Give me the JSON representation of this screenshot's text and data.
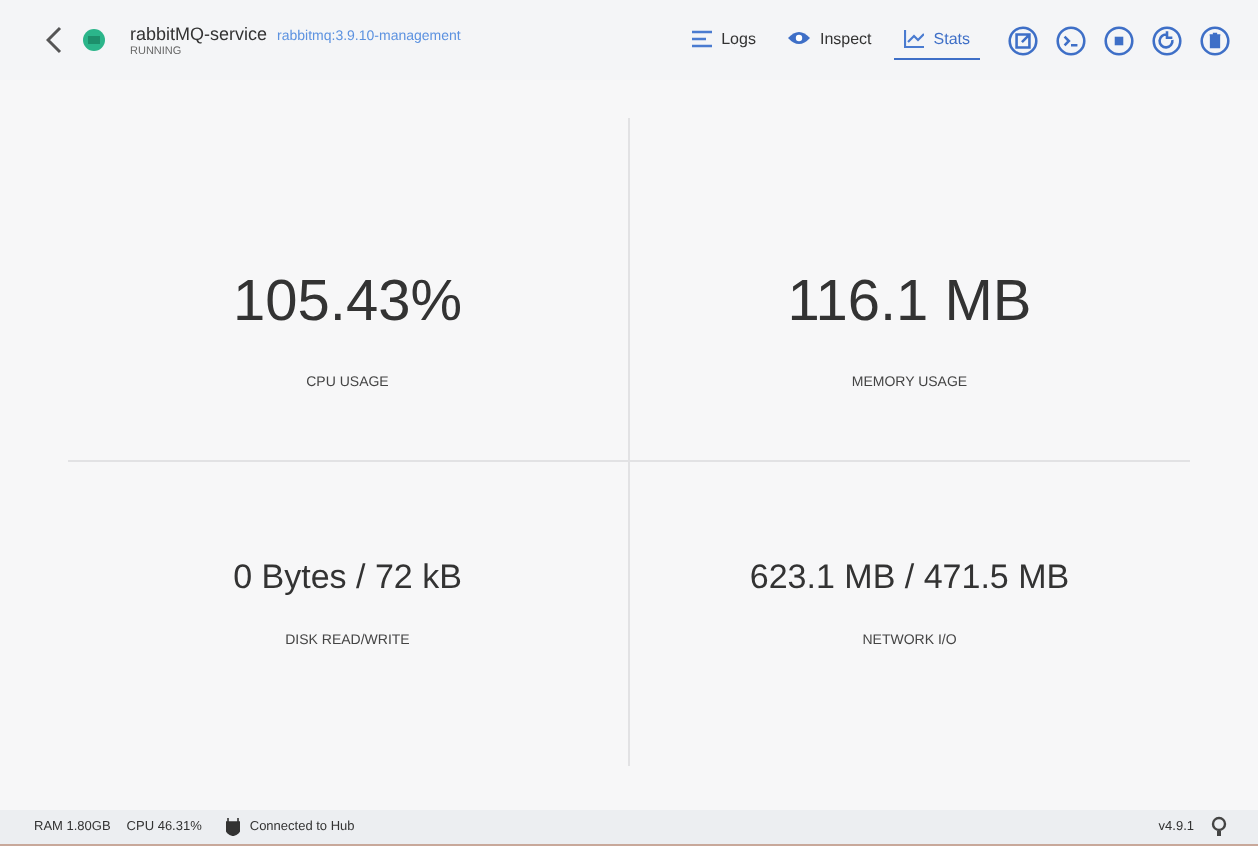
{
  "header": {
    "name": "rabbitMQ-service",
    "image": "rabbitmq:3.9.10-management",
    "status": "RUNNING"
  },
  "tabs": [
    {
      "kind": "logs",
      "label": "Logs",
      "selected": false
    },
    {
      "kind": "inspect",
      "label": "Inspect",
      "selected": false
    },
    {
      "kind": "stats",
      "label": "Stats",
      "selected": true
    }
  ],
  "actions": [
    {
      "kind": "open"
    },
    {
      "kind": "terminal"
    },
    {
      "kind": "stop"
    },
    {
      "kind": "restart"
    },
    {
      "kind": "delete"
    }
  ],
  "stats": [
    {
      "value": "105.43%",
      "label": "CPU USAGE"
    },
    {
      "value": "116.1 MB",
      "label": "MEMORY USAGE"
    },
    {
      "value": "0 Bytes / 72 kB",
      "label": "DISK READ/WRITE"
    },
    {
      "value": "623.1 MB / 471.5 MB",
      "label": "NETWORK I/O"
    }
  ],
  "status_bar": {
    "ram": "RAM 1.80GB",
    "cpu": "CPU 46.31%",
    "connection": "Connected to Hub",
    "version": "v4.9.1"
  }
}
